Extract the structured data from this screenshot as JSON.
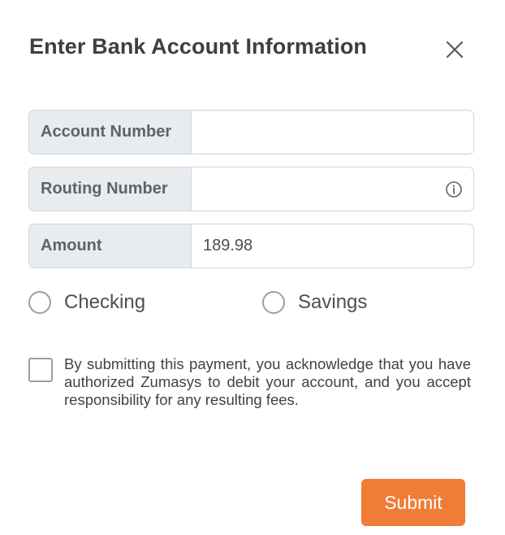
{
  "dialog": {
    "title": "Enter Bank Account Information",
    "close_icon": "close-icon"
  },
  "fields": {
    "account_number": {
      "label": "Account Number",
      "value": "",
      "placeholder": ""
    },
    "routing_number": {
      "label": "Routing Number",
      "value": "",
      "placeholder": "",
      "icon": "info-icon"
    },
    "amount": {
      "label": "Amount",
      "value": "189.98",
      "placeholder": ""
    }
  },
  "account_type": {
    "options": [
      "Checking",
      "Savings"
    ],
    "selected": ""
  },
  "consent": {
    "checked": false,
    "text": "By submitting this payment, you acknowledge that you have authorized Zumasys to debit your account, and you accept responsibility for any resulting fees."
  },
  "actions": {
    "submit_label": "Submit"
  },
  "colors": {
    "accent": "#f07c35",
    "label_bg": "#e9ecef",
    "border": "#ced4da",
    "text": "#3a4046"
  }
}
